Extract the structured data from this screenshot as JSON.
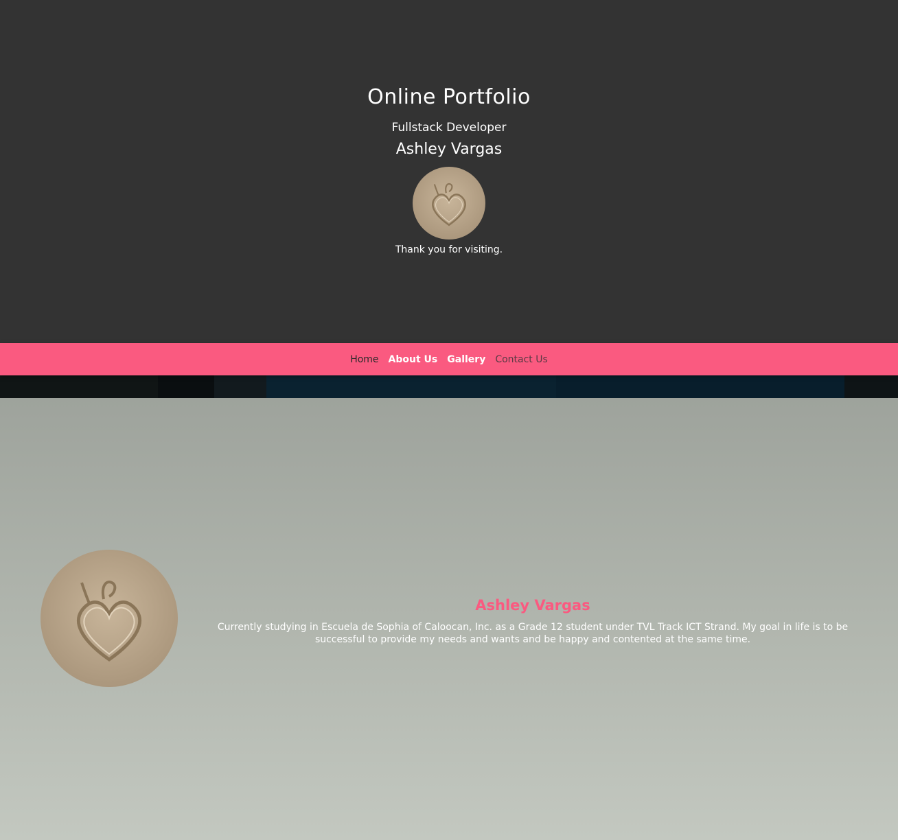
{
  "hero": {
    "title": "Online Portfolio",
    "role": "Fullstack Developer",
    "name": "Ashley Vargas",
    "thanks": "Thank you for visiting.",
    "background": "#333333"
  },
  "nav": {
    "items": [
      {
        "label": "Home"
      },
      {
        "label": "About Us"
      },
      {
        "label": "Gallery"
      },
      {
        "label": "Contact Us"
      }
    ],
    "background": "#fa5a80"
  },
  "about": {
    "name": "Ashley Vargas",
    "description": "Currently studying in Escuela de Sophia of Caloocan, Inc. as a Grade 12 student under TVL Track ICT Strand. My goal in life is to be successful to provide my needs and wants and be happy and contented at the same time.",
    "accent": "#fa5a80"
  },
  "images": {
    "avatar": "sand-heart-drawing"
  }
}
